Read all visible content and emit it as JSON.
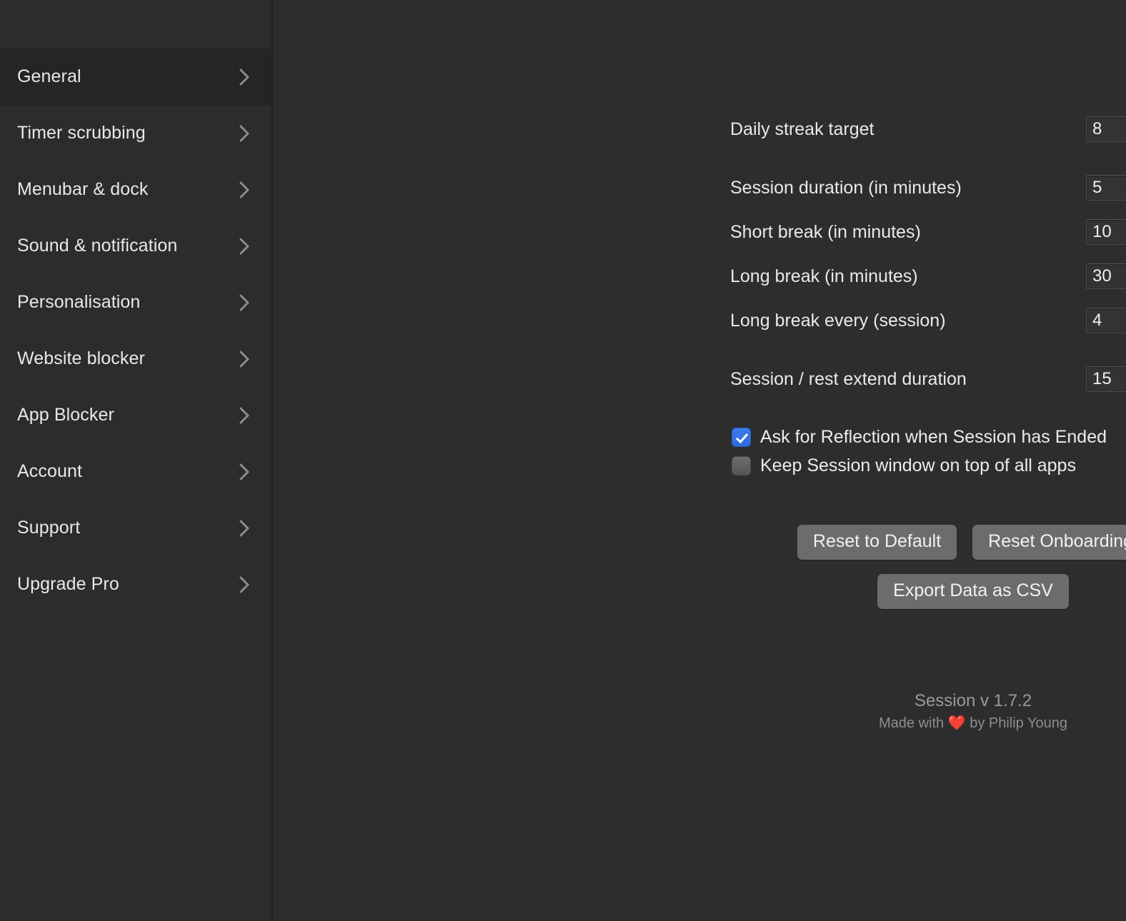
{
  "sidebar": {
    "selected": "General",
    "items": [
      {
        "label": "General",
        "icon": "chevron-right-icon",
        "selected": true
      },
      {
        "label": "Timer scrubbing",
        "icon": "chevron-right-icon",
        "selected": false
      },
      {
        "label": "Menubar & dock",
        "icon": "chevron-right-icon",
        "selected": false
      },
      {
        "label": "Sound & notification",
        "icon": "chevron-right-icon",
        "selected": false
      },
      {
        "label": "Personalisation",
        "icon": "chevron-right-icon",
        "selected": false
      },
      {
        "label": "Website blocker",
        "icon": "chevron-right-icon",
        "selected": false
      },
      {
        "label": "App Blocker",
        "icon": "chevron-right-icon",
        "selected": false
      },
      {
        "label": "Account",
        "icon": "chevron-right-icon",
        "selected": false
      },
      {
        "label": "Support",
        "icon": "chevron-right-icon",
        "selected": false
      },
      {
        "label": "Upgrade Pro",
        "icon": "chevron-right-icon",
        "selected": false
      }
    ]
  },
  "settings": {
    "fields": [
      {
        "label": "Daily streak target",
        "value": "8"
      },
      {
        "label": "Session duration (in minutes)",
        "value": "5"
      },
      {
        "label": "Short break (in minutes)",
        "value": "10"
      },
      {
        "label": "Long break (in minutes)",
        "value": "30"
      },
      {
        "label": "Long break every (session)",
        "value": "4"
      },
      {
        "label": "Session / rest extend duration",
        "value": "15"
      }
    ],
    "checkboxes": [
      {
        "label": "Ask for Reflection when Session has Ended",
        "checked": true
      },
      {
        "label": "Keep Session window on top of all apps",
        "checked": false
      }
    ],
    "buttons": {
      "reset_default": "Reset to Default",
      "reset_onboarding": "Reset Onboarding",
      "export_csv": "Export Data as CSV"
    }
  },
  "footer": {
    "version": "Session v 1.7.2",
    "credit_prefix": "Made with ",
    "heart": "❤️",
    "credit_suffix": " by Philip Young"
  },
  "colors": {
    "background": "#2d2d2d",
    "sidebar": "#2c2c2c",
    "sidebar_selected": "#252525",
    "accent_checkbox": "#3b7bee",
    "button": "#6c6c6c",
    "heart": "#e04b43"
  }
}
